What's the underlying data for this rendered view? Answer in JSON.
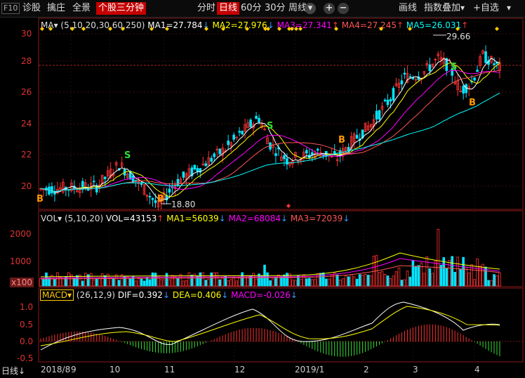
{
  "topbar": {
    "f10": "F10",
    "zhengduan": "诊股",
    "zhuozhu": "擒庄",
    "quanjing": "全景",
    "sanfen": "个股三分钟",
    "timeframes": [
      "分时",
      "日线",
      "60分",
      "30分",
      "周线"
    ],
    "timeframe_active": "日线",
    "weekly_dropdown": "▾",
    "prev": "◂",
    "next": "▸",
    "plus": "+",
    "minus": "−",
    "draw_line": "画线",
    "index_overlay": "指数叠加",
    "add_self": "+自选"
  },
  "price_panel": {
    "ma_label": "MA",
    "params": "(5,10,20,30,60,250)",
    "ma1": "MA1=27.784",
    "ma2": "MA2=27.976",
    "ma3": "MA3=27.341",
    "ma4": "MA4=27.245",
    "ma5": "MA5=26.031",
    "ma1_arrow": "↓",
    "ma2_arrow": "↓",
    "ma3_arrow": "↑",
    "ma4_arrow": "↑",
    "ma5_arrow": "↑",
    "y_ticks": [
      "30",
      "28",
      "26",
      "24",
      "22",
      "20"
    ],
    "high_label": "29.66",
    "low_label": "18.80",
    "signals": [
      {
        "text": "S",
        "color": "#33dd33"
      },
      {
        "text": "S",
        "color": "#33dd33"
      },
      {
        "text": "S",
        "color": "#33dd33"
      },
      {
        "text": "B",
        "color": "#ff9900"
      },
      {
        "text": "B",
        "color": "#ff9900"
      },
      {
        "text": "B",
        "color": "#ff9900"
      },
      {
        "text": "B",
        "color": "#ff9900"
      }
    ]
  },
  "vol_panel": {
    "label": "VOL",
    "params": "(5,10,20)",
    "vol": "VOL=43153",
    "vol_arrow": "↑",
    "ma1": "MA1=56039",
    "ma1_arrow": "↓",
    "ma2": "MA2=68084",
    "ma2_arrow": "↓",
    "ma3": "MA3=72039",
    "ma3_arrow": "↓",
    "y_ticks": [
      "2000",
      "1000",
      "x100"
    ]
  },
  "macd_panel": {
    "label": "MACD",
    "params": "(26,12,9)",
    "dif": "DIF=0.392",
    "dif_arrow": "↓",
    "dea": "DEA=0.406",
    "dea_arrow": "↓",
    "macd": "MACD=-0.026",
    "macd_arrow": "↓",
    "y_ticks": [
      "1.0",
      "0.5",
      "0.0",
      "-0.5"
    ]
  },
  "x_axis": {
    "period": "日线",
    "period_arrow": "↓",
    "labels": [
      "2018/8",
      "9",
      "10",
      "11",
      "12",
      "2019/1",
      "2",
      "3",
      "4"
    ]
  },
  "colors": {
    "up": "#ff3232",
    "down": "#00e5ff",
    "ma1": "#ffffff",
    "ma2": "#ffff00",
    "ma3": "#ff00ff",
    "ma4": "#ff5555",
    "ma5": "#00ffff",
    "axis": "#cc2222",
    "diamond": "#ffcc00"
  }
}
